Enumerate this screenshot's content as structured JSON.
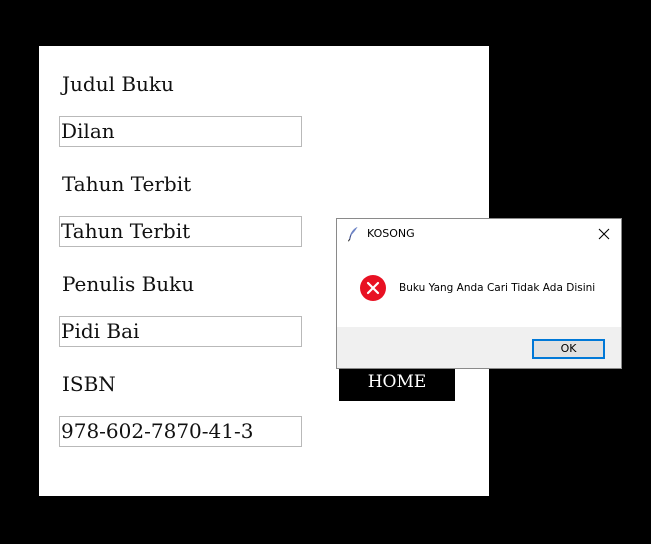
{
  "form": {
    "fields": [
      {
        "label": "Judul Buku",
        "value": "Dilan"
      },
      {
        "label": "Tahun Terbit",
        "value": "Tahun Terbit"
      },
      {
        "label": "Penulis Buku",
        "value": "Pidi Bai"
      },
      {
        "label": "ISBN",
        "value": "978-602-7870-41-3"
      }
    ],
    "home_label": "HOME"
  },
  "dialog": {
    "title": "KOSONG",
    "message": "Buku Yang Anda Cari Tidak Ada Disini",
    "ok_label": "OK",
    "title_icon": "feather-icon",
    "message_icon": "error-icon",
    "error_color": "#e81123",
    "accent_color": "#0078d7"
  }
}
